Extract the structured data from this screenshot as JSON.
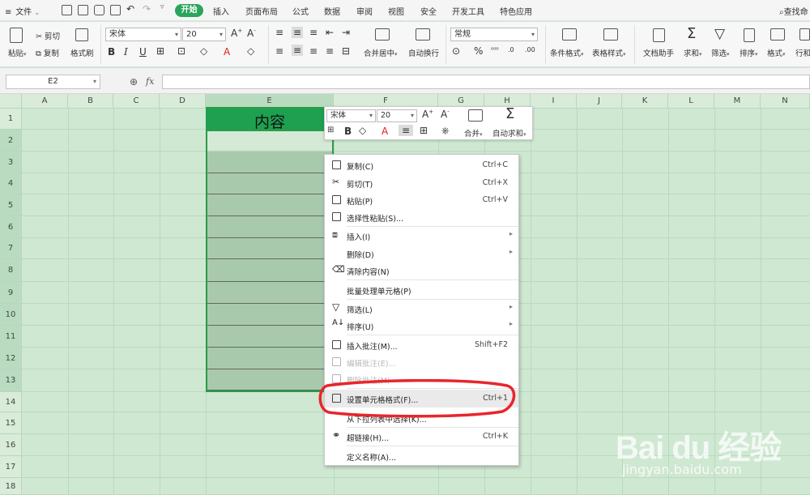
{
  "menubar": {
    "file_label": "文件",
    "tabs": [
      "开始",
      "插入",
      "页面布局",
      "公式",
      "数据",
      "审阅",
      "视图",
      "安全",
      "开发工具",
      "特色应用"
    ],
    "search_label": "查找命"
  },
  "ribbon": {
    "paste": "粘贴",
    "cut": "剪切",
    "copy": "复制",
    "format_painter": "格式刷",
    "font_name": "宋体",
    "font_size": "20",
    "merge_center": "合并居中",
    "wrap_text": "自动换行",
    "number_format": "常规",
    "conditional_format": "条件格式",
    "table_style": "表格样式",
    "doc_helper": "文档助手",
    "sum": "求和",
    "filter": "筛选",
    "sort": "排序",
    "format": "格式",
    "rows_cols": "行和"
  },
  "formula_bar": {
    "name_box": "E2",
    "fx": "fx",
    "value": ""
  },
  "sheet": {
    "columns": [
      "A",
      "B",
      "C",
      "D",
      "E",
      "F",
      "G",
      "H",
      "I",
      "J",
      "K",
      "L",
      "M",
      "N"
    ],
    "rows": [
      "1",
      "2",
      "3",
      "4",
      "5",
      "6",
      "7",
      "8",
      "9",
      "10",
      "11",
      "12",
      "13",
      "14",
      "15",
      "16",
      "17",
      "18"
    ],
    "e1_text": "内容"
  },
  "mini_toolbar": {
    "font_name": "宋体",
    "font_size": "20",
    "merge": "合并",
    "autosum": "自动求和"
  },
  "context_menu": {
    "items": [
      {
        "label": "复制(C)",
        "shortcut": "Ctrl+C"
      },
      {
        "label": "剪切(T)",
        "shortcut": "Ctrl+X"
      },
      {
        "label": "粘贴(P)",
        "shortcut": "Ctrl+V"
      },
      {
        "label": "选择性粘贴(S)...",
        "shortcut": ""
      },
      {
        "label": "插入(I)",
        "shortcut": ""
      },
      {
        "label": "删除(D)",
        "shortcut": ""
      },
      {
        "label": "清除内容(N)",
        "shortcut": ""
      },
      {
        "label": "批量处理单元格(P)",
        "shortcut": ""
      },
      {
        "label": "筛选(L)",
        "shortcut": ""
      },
      {
        "label": "排序(U)",
        "shortcut": ""
      },
      {
        "label": "插入批注(M)...",
        "shortcut": "Shift+F2"
      },
      {
        "label": "编辑批注(E)...",
        "shortcut": ""
      },
      {
        "label": "删除批注(M)",
        "shortcut": ""
      },
      {
        "label": "设置单元格格式(F)...",
        "shortcut": "Ctrl+1"
      },
      {
        "label": "从下拉列表中选择(K)...",
        "shortcut": ""
      },
      {
        "label": "超链接(H)...",
        "shortcut": "Ctrl+K"
      },
      {
        "label": "定义名称(A)...",
        "shortcut": ""
      }
    ]
  },
  "watermark": {
    "brand": "Bai du 经验",
    "url": "jingyan.baidu.com"
  },
  "colors": {
    "accent": "#2aa55b",
    "highlight_ring": "#e8262c"
  }
}
